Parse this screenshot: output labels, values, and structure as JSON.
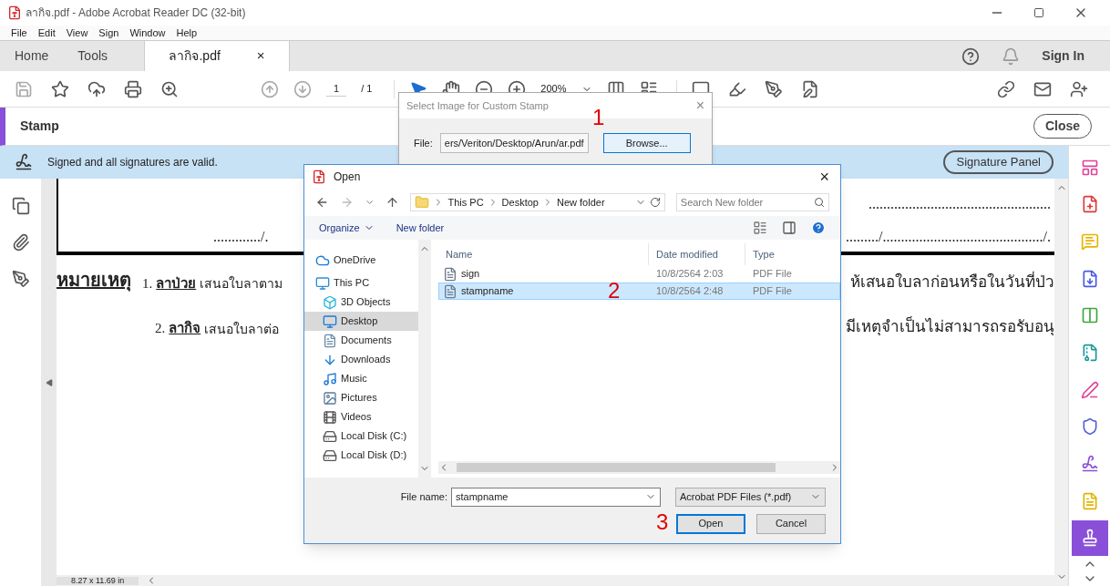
{
  "window": {
    "title": "ลากิจ.pdf - Adobe Acrobat Reader DC (32-bit)"
  },
  "menu": [
    "File",
    "Edit",
    "View",
    "Sign",
    "Window",
    "Help"
  ],
  "nav_tabs": [
    {
      "label": "Home",
      "selected": false
    },
    {
      "label": "Tools",
      "selected": false
    },
    {
      "label": "ลากิจ.pdf",
      "selected": true
    }
  ],
  "doc_tab_close": "×",
  "sign_in": "Sign In",
  "page_nav": {
    "current": "1",
    "total": "/ 1"
  },
  "zoom": "200%",
  "tool_panel": {
    "title": "Stamp",
    "close": "Close"
  },
  "notice": {
    "text": "Signed and all signatures are valid.",
    "button": "Signature Panel"
  },
  "document": {
    "dotted_left": "............./.",
    "dotted_right_top": "..................................................",
    "dotted_right": "........./............................................/.",
    "note_label": "หมายเหตุ",
    "items": [
      {
        "number": "1.",
        "term": "ลาป่วย",
        "text": "เสนอใบลาตาม",
        "text_right": "ห้เสนอใบลาก่อนหรือในวันที่ป่ว"
      },
      {
        "number": "2.",
        "term": "ลากิจ",
        "text": "เสนอใบลาต่อ",
        "text_right": "มีเหตุจำเป็นไม่สามารถรอรับอนุ"
      }
    ]
  },
  "page_size": "8.27 x 11.69 in",
  "right_tools": [
    {
      "selected": false
    },
    {
      "selected": false
    },
    {
      "selected": false
    },
    {
      "selected": false
    },
    {
      "selected": false
    },
    {
      "selected": false
    },
    {
      "selected": false
    },
    {
      "selected": false
    },
    {
      "selected": false
    },
    {
      "selected": false
    },
    {
      "selected": true
    }
  ],
  "stamp_dialog": {
    "title": "Select Image for Custom Stamp",
    "close": "×",
    "file_label": "File:",
    "file_value": "ers/Veriton/Desktop/Arun/ar.pdf",
    "browse": "Browse..."
  },
  "open_dialog": {
    "title": "Open",
    "close": "×",
    "breadcrumb": [
      "This PC",
      "Desktop",
      "New folder"
    ],
    "search_placeholder": "Search New folder",
    "organize": "Organize",
    "new_folder": "New folder",
    "nav_items": [
      {
        "label": "OneDrive",
        "selected": false
      },
      {
        "label": "This PC",
        "selected": false,
        "children": [
          {
            "label": "3D Objects",
            "selected": false
          },
          {
            "label": "Desktop",
            "selected": true
          },
          {
            "label": "Documents",
            "selected": false
          },
          {
            "label": "Downloads",
            "selected": false
          },
          {
            "label": "Music",
            "selected": false
          },
          {
            "label": "Pictures",
            "selected": false
          },
          {
            "label": "Videos",
            "selected": false
          },
          {
            "label": "Local Disk (C:)",
            "selected": false
          },
          {
            "label": "Local Disk (D:)",
            "selected": false
          }
        ]
      }
    ],
    "columns": [
      "Name",
      "Date modified",
      "Type"
    ],
    "files": [
      {
        "name": "sign",
        "date": "10/8/2564 2:03",
        "type": "PDF File",
        "selected": false
      },
      {
        "name": "stampname",
        "date": "10/8/2564 2:48",
        "type": "PDF File",
        "selected": true
      }
    ],
    "file_name_label": "File name:",
    "file_name": "stampname",
    "file_type": "Acrobat PDF Files (*.pdf)",
    "open": "Open",
    "cancel": "Cancel"
  },
  "annotations": [
    "1",
    "2",
    "3"
  ]
}
